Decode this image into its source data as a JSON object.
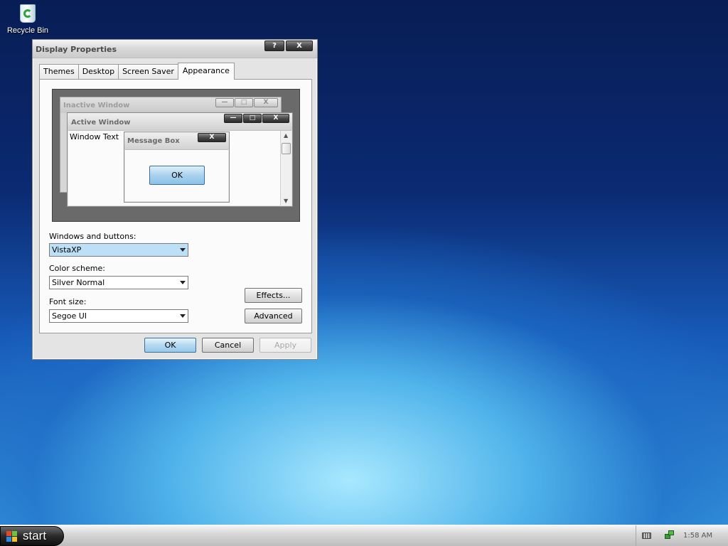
{
  "desktop": {
    "recycle_bin_label": "Recycle Bin"
  },
  "dialog": {
    "title": "Display Properties",
    "help_button": "?",
    "close_button": "X",
    "tabs": [
      {
        "label": "Themes",
        "active": false
      },
      {
        "label": "Desktop",
        "active": false
      },
      {
        "label": "Screen Saver",
        "active": false
      },
      {
        "label": "Appearance",
        "active": true
      }
    ],
    "preview": {
      "inactive_title": "Inactive Window",
      "active_title": "Active Window",
      "window_text": "Window Text",
      "message_box_title": "Message Box",
      "message_box_ok": "OK",
      "min_glyph": "—",
      "max_glyph": "□",
      "close_glyph": "X",
      "scroll_up_glyph": "▲",
      "scroll_down_glyph": "▼"
    },
    "windows_and_buttons": {
      "label": "Windows and buttons:",
      "value": "VistaXP"
    },
    "color_scheme": {
      "label": "Color scheme:",
      "value": "Silver Normal"
    },
    "font_size": {
      "label": "Font size:",
      "value": "Segoe UI"
    },
    "effects_button": "Effects...",
    "advanced_button": "Advanced",
    "ok_button": "OK",
    "cancel_button": "Cancel",
    "apply_button": "Apply"
  },
  "taskbar": {
    "start_label": "start",
    "clock": "1:58 AM"
  },
  "colors": {
    "accent": "#a9d2ee",
    "taskbar": "#d8d8d8",
    "start_button": "#2a2a2a"
  },
  "icons": [
    "recycle-bin-icon",
    "windows-flag-icon",
    "keyboard-icon",
    "network-icon"
  ]
}
